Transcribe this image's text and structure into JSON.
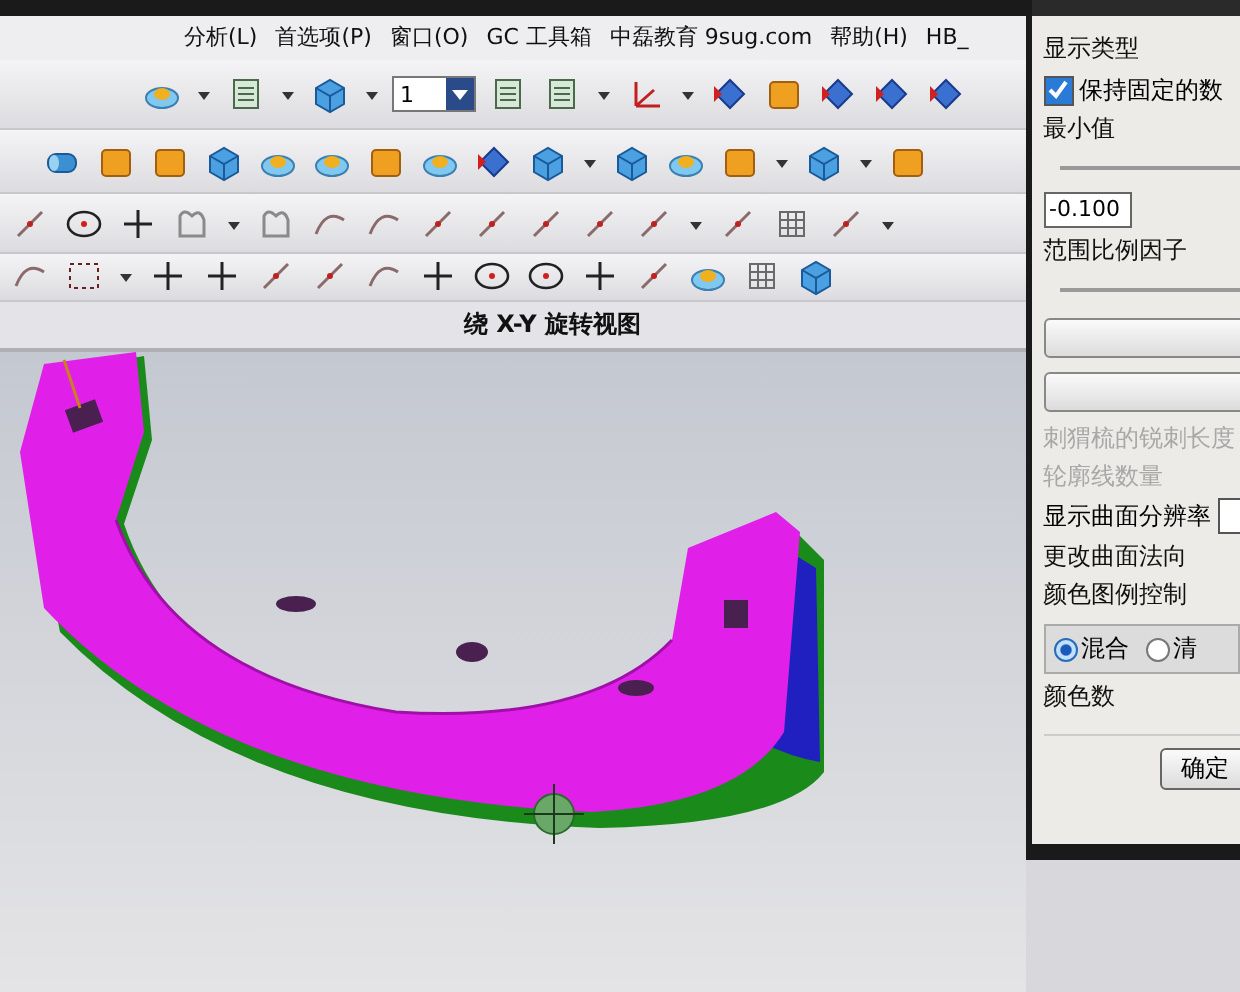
{
  "menu": [
    {
      "label": "分析(L)"
    },
    {
      "label": "首选项(P)"
    },
    {
      "label": "窗口(O)"
    },
    {
      "label": "GC 工具箱"
    },
    {
      "label": "中磊教育 9sug.com"
    },
    {
      "label": "帮助(H)"
    },
    {
      "label": "HB_"
    }
  ],
  "layer_field": {
    "value": "1"
  },
  "view_title": "绕 X-Y 旋转视图",
  "dialog": {
    "items": [
      {
        "kind": "heading",
        "label": "显示类型"
      },
      {
        "kind": "checkbox",
        "label": "保持固定的数",
        "checked": true
      },
      {
        "kind": "label",
        "label": "最小值"
      },
      {
        "kind": "slider"
      },
      {
        "kind": "field",
        "value": "-0.100"
      },
      {
        "kind": "label",
        "label": "范围比例因子"
      },
      {
        "kind": "slider"
      },
      {
        "kind": "button"
      },
      {
        "kind": "button"
      },
      {
        "kind": "label",
        "label": "刺猬梳的锐刺长度",
        "disabled": true
      },
      {
        "kind": "label",
        "label": "轮廓线数量",
        "disabled": true
      },
      {
        "kind": "select",
        "label": "显示曲面分辨率"
      },
      {
        "kind": "label",
        "label": "更改曲面法向"
      },
      {
        "kind": "heading",
        "label": "颜色图例控制"
      },
      {
        "kind": "radios",
        "options": [
          {
            "label": "混合",
            "selected": true
          },
          {
            "label": "清",
            "selected": false
          }
        ]
      },
      {
        "kind": "label",
        "label": "颜色数"
      },
      {
        "kind": "ok",
        "label": "确定"
      }
    ]
  }
}
